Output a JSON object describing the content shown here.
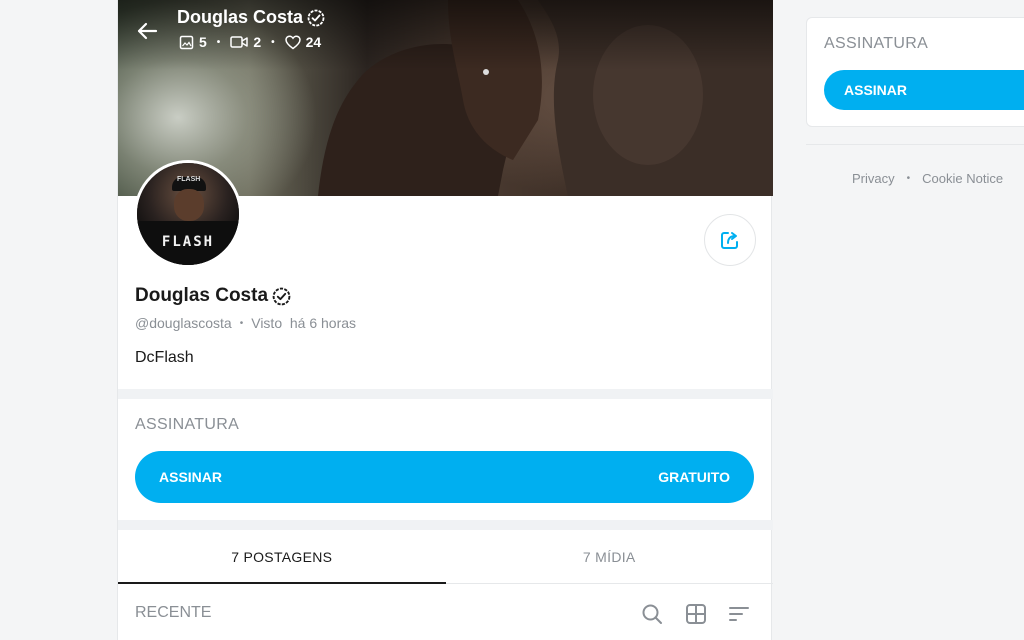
{
  "header": {
    "name": "Douglas Costa",
    "stats": {
      "photos": "5",
      "videos": "2",
      "likes": "24"
    }
  },
  "profile": {
    "name": "Douglas Costa",
    "handle": "@douglascosta",
    "separator": "•",
    "last_seen": "Visto  há 6 horas",
    "bio": "DcFlash",
    "avatar_text": "FLASH",
    "avatar_cap_text": "FLASH"
  },
  "subscription": {
    "title": "ASSINATURA",
    "button_label": "ASSINAR",
    "price_label": "GRATUITO"
  },
  "tabs": [
    {
      "label": "7 POSTAGENS",
      "active": true
    },
    {
      "label": "7 MÍDIA",
      "active": false
    }
  ],
  "filter": {
    "label": "RECENTE"
  },
  "sidebar": {
    "title": "ASSINATURA",
    "button_label": "ASSINAR",
    "footer": {
      "privacy": "Privacy",
      "dot": "•",
      "cookie": "Cookie Notice"
    }
  },
  "colors": {
    "accent": "#00aff0",
    "muted_text": "#8a8f95",
    "background": "#f4f5f6"
  }
}
